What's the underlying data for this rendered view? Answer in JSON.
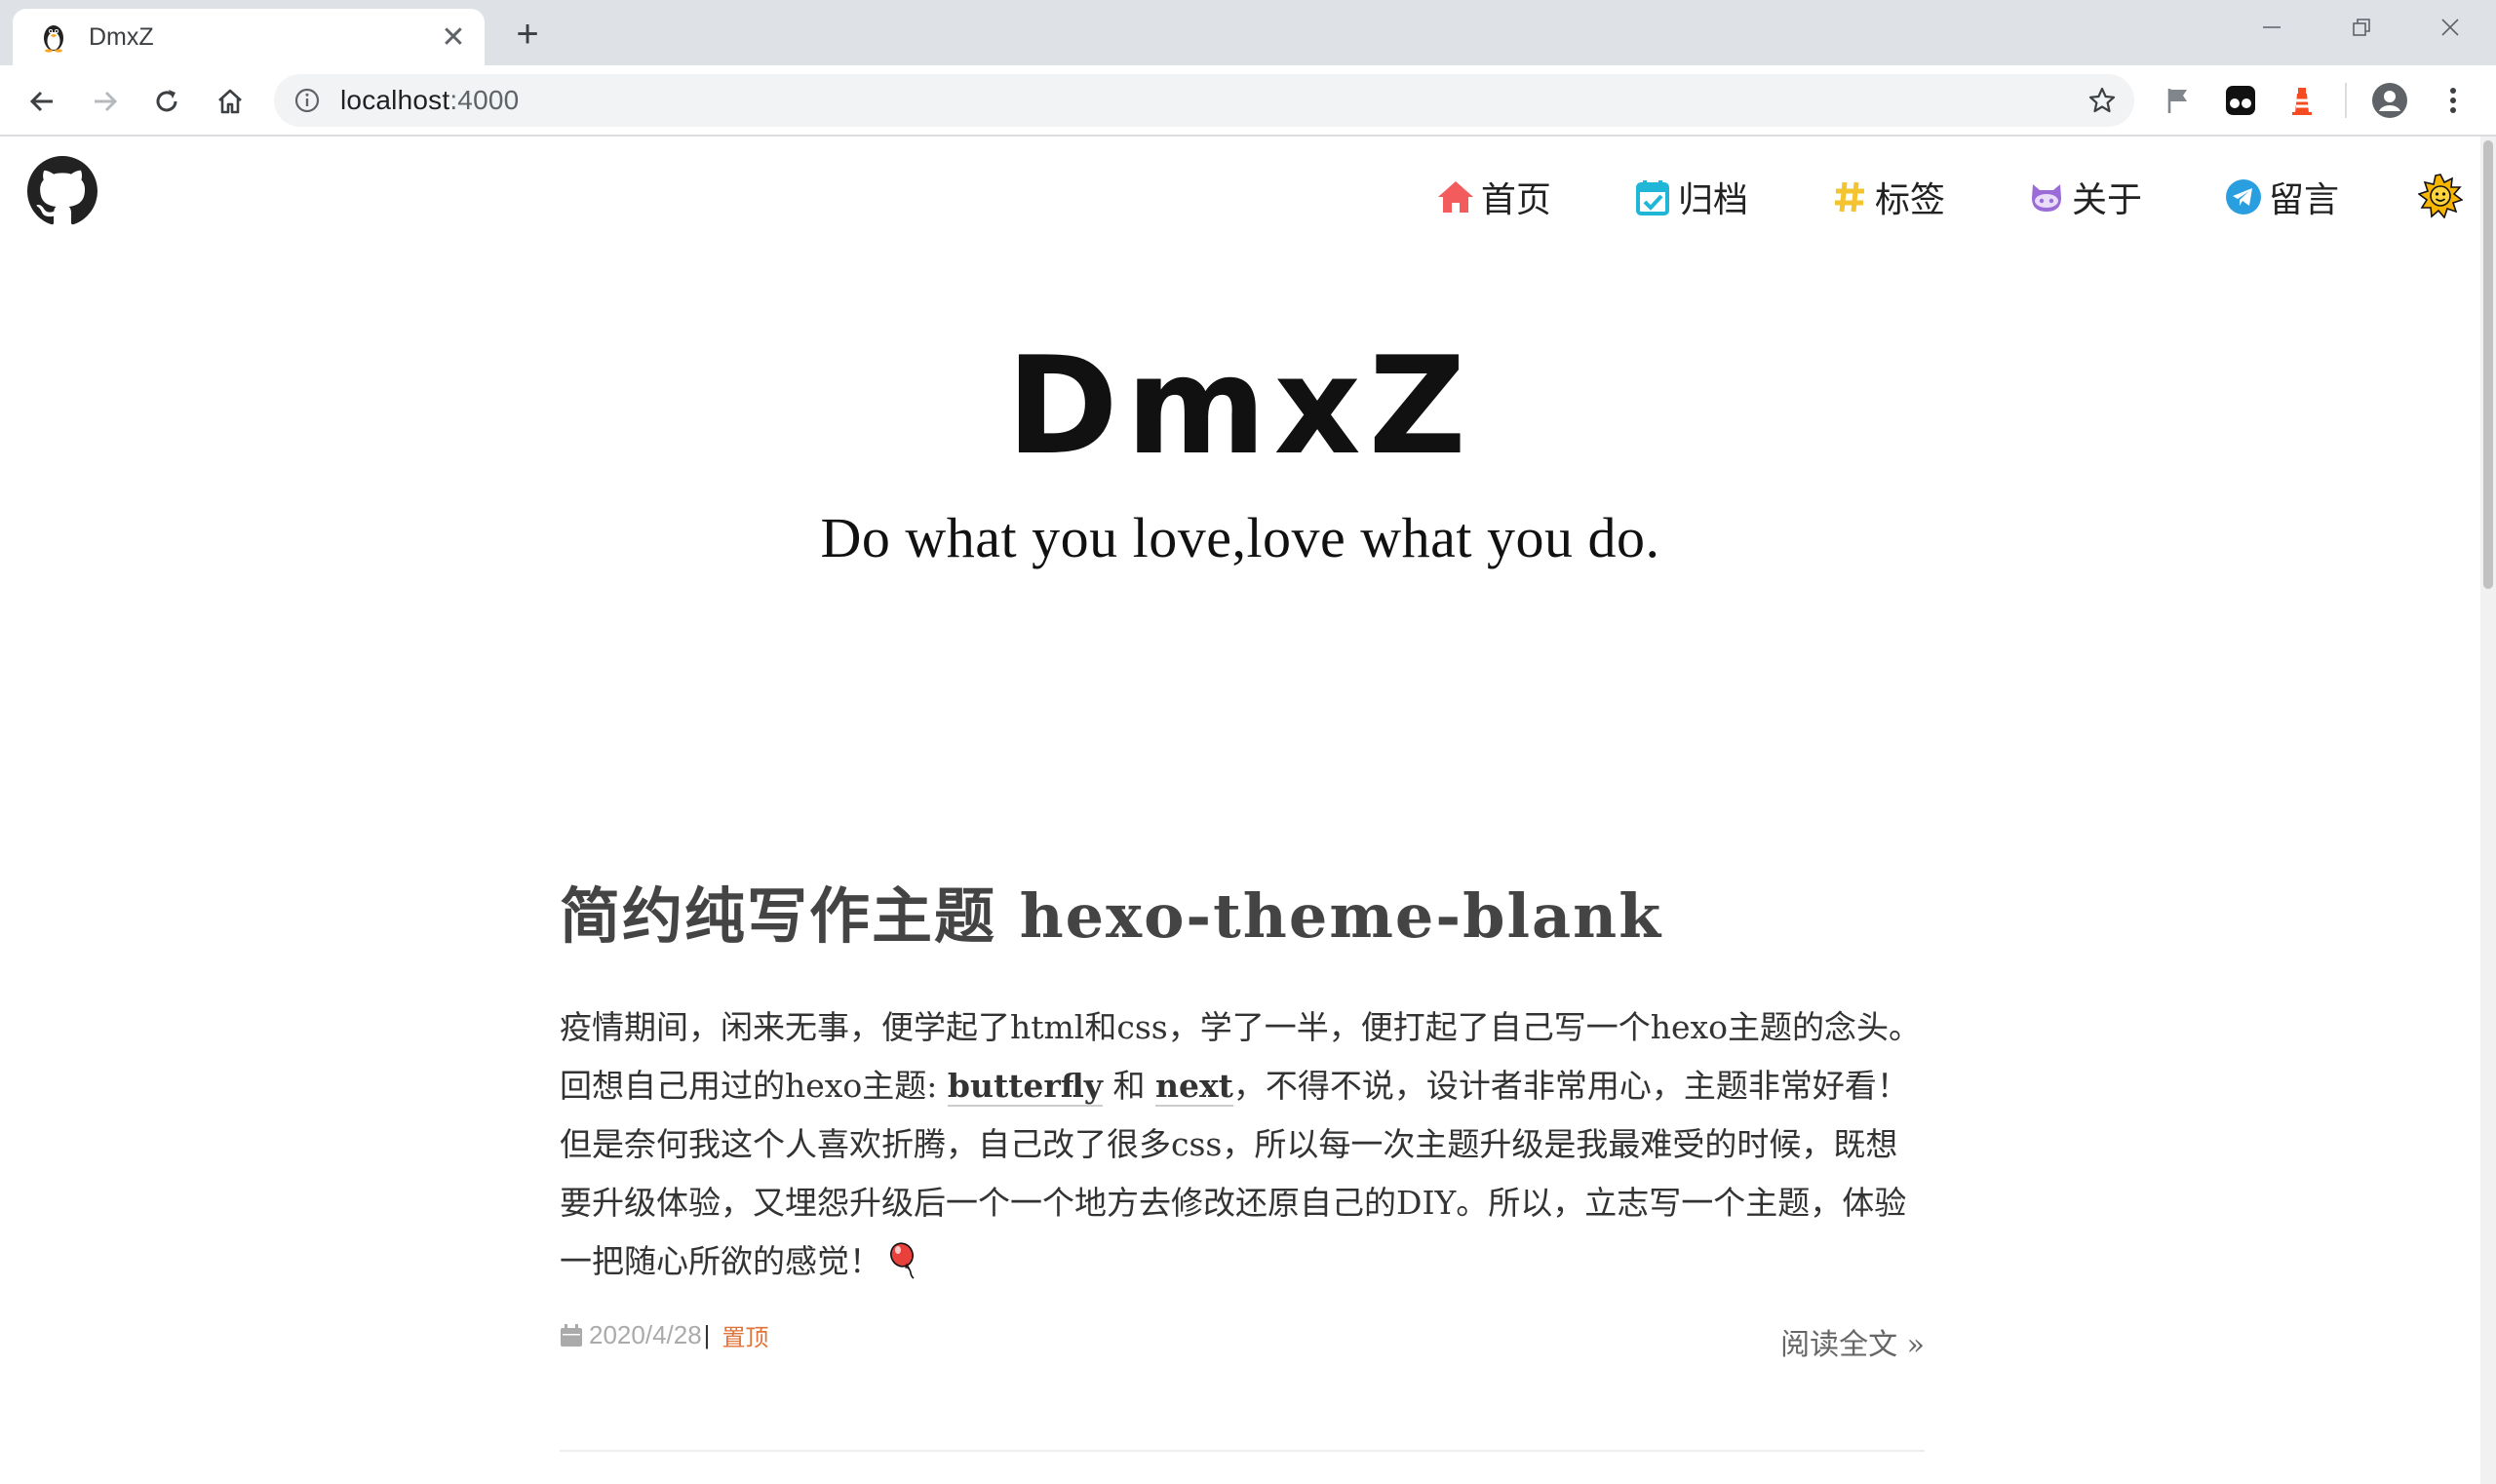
{
  "browser": {
    "tab_title": "DmxZ",
    "url_host": "localhost",
    "url_port": ":4000"
  },
  "site": {
    "title": "DmxZ",
    "subtitle": "Do what you love,love what you do.",
    "nav": [
      {
        "label": "首页",
        "icon": "home-icon",
        "color": "#f25c5c"
      },
      {
        "label": "归档",
        "icon": "calendar-check-icon",
        "color": "#1fb6d8"
      },
      {
        "label": "标签",
        "icon": "hashtag-icon",
        "color": "#f4c430"
      },
      {
        "label": "关于",
        "icon": "github-cat-icon",
        "color": "#9b6bd8"
      },
      {
        "label": "留言",
        "icon": "telegram-icon",
        "color": "#2a9fe0"
      }
    ]
  },
  "post": {
    "title": "简约纯写作主题 hexo-theme-blank",
    "excerpt_1": "疫情期间，闲来无事，便学起了html和css，学了一半，便打起了自己写一个hexo主题的念头。回想自己用过的hexo主题: ",
    "link_1": "butterfly",
    "and": " 和 ",
    "link_2": "next",
    "excerpt_2": "，不得不说，设计者非常用心，主题非常好看！但是奈何我这个人喜欢折腾，自己改了很多css，所以每一次主题升级是我最难受的时候，既想要升级体验，又埋怨升级后一个一个地方去修改还原自己的DIY。所以，立志写一个主题，体验一把随心所欲的感觉！",
    "date": "2020/4/28",
    "sep": "|",
    "pinned": "置顶",
    "read_more": "阅读全文 »"
  }
}
